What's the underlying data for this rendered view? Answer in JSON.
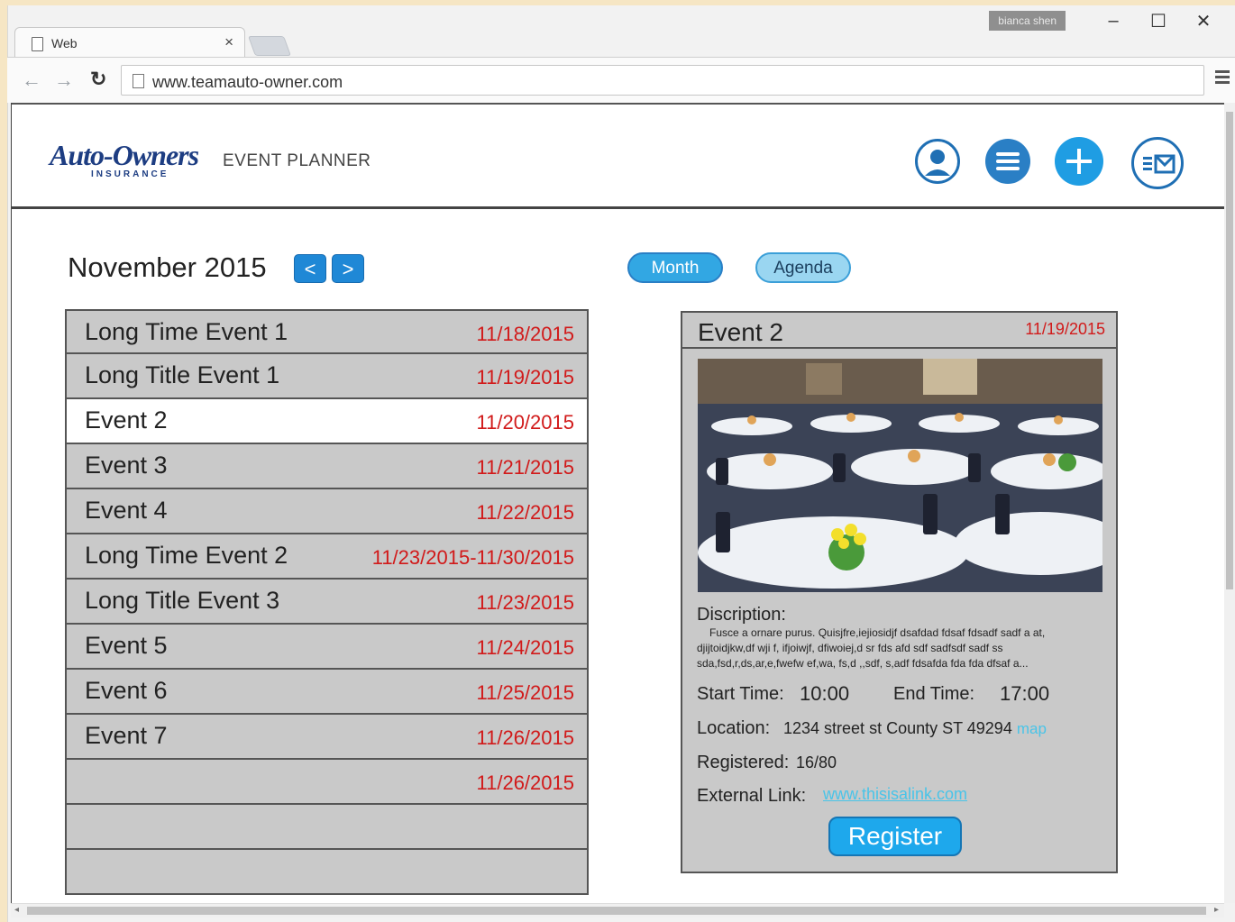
{
  "browser": {
    "window_user": "bianca shen",
    "tab_title": "Web",
    "url": "www.teamauto-owner.com"
  },
  "header": {
    "logo_name": "Auto-Owners",
    "logo_sub": "INSURANCE",
    "app_title": "EVENT PLANNER",
    "icons": [
      "user-profile-icon",
      "menu-list-icon",
      "add-event-icon",
      "mail-icon"
    ]
  },
  "calendar": {
    "month_label": "November 2015",
    "prev_label": "<",
    "next_label": ">",
    "view_month": "Month",
    "view_agenda": "Agenda"
  },
  "events": [
    {
      "name": "Long Time Event 1",
      "date": "11/18/2015"
    },
    {
      "name": "Long Title Event 1",
      "date": "11/19/2015"
    },
    {
      "name": "Event 2",
      "date": "11/20/2015",
      "selected": true
    },
    {
      "name": "Event 3",
      "date": "11/21/2015"
    },
    {
      "name": "Event 4",
      "date": "11/22/2015"
    },
    {
      "name": "Long Time Event 2",
      "date": "11/23/2015-11/30/2015"
    },
    {
      "name": "Long Title Event 3",
      "date": "11/23/2015"
    },
    {
      "name": "Event 5",
      "date": "11/24/2015"
    },
    {
      "name": "Event 6",
      "date": "11/25/2015"
    },
    {
      "name": "Event 7",
      "date": "11/26/2015"
    },
    {
      "name": "",
      "date": "11/26/2015"
    },
    {
      "name": "",
      "date": ""
    },
    {
      "name": "",
      "date": ""
    }
  ],
  "detail": {
    "title": "Event 2",
    "date": "11/19/2015",
    "description_label": "Discription:",
    "description": "Fusce a ornare purus. Quisjfre,iejiosidjf dsafdad fdsaf fdsadf sadf a at, djijtoidjkw,df wji f, ifjoiwjf, dfiwoiej,d sr fds afd sdf sadfsdf sadf ss sda,fsd,r,ds,ar,e,fwefw ef,wa, fs,d ,,sdf, s,adf fdsafda fda fda dfsaf a...",
    "start_label": "Start Time:",
    "start_value": "10:00",
    "end_label": "End Time:",
    "end_value": "17:00",
    "location_label": "Location:",
    "location_value": "1234 street st County ST 49294",
    "map_link": "map",
    "registered_label": "Registered:",
    "registered_value": "16/80",
    "external_label": "External Link:",
    "external_value": "www.thisisalink.com",
    "register_button": "Register"
  },
  "colors": {
    "accent": "#1f88d6",
    "date_red": "#d11a1a",
    "link_cyan": "#49c4e8",
    "row_gray": "#c9c9c9"
  }
}
